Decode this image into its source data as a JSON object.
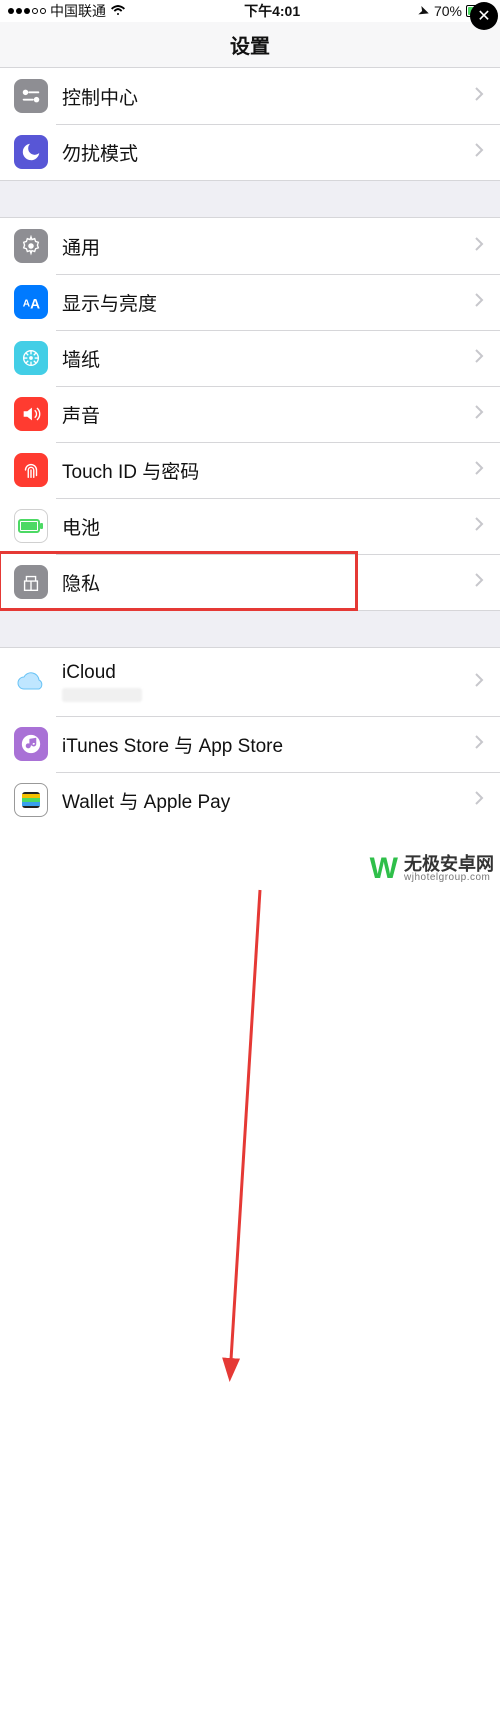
{
  "status": {
    "carrier": "中国联通",
    "time": "下午4:01",
    "battery_pct": "70%",
    "battery_fill_pct": 70
  },
  "navbar": {
    "title": "设置"
  },
  "groups": [
    {
      "items": [
        {
          "key": "control",
          "label": "控制中心"
        },
        {
          "key": "dnd",
          "label": "勿扰模式"
        }
      ]
    },
    {
      "items": [
        {
          "key": "general",
          "label": "通用"
        },
        {
          "key": "display",
          "label": "显示与亮度"
        },
        {
          "key": "wallpaper",
          "label": "墙纸"
        },
        {
          "key": "sound",
          "label": "声音"
        },
        {
          "key": "touchid",
          "label": "Touch ID 与密码"
        },
        {
          "key": "battery",
          "label": "电池"
        },
        {
          "key": "privacy",
          "label": "隐私",
          "highlighted": true
        }
      ]
    },
    {
      "items": [
        {
          "key": "icloud",
          "label": "iCloud",
          "has_sub": true
        },
        {
          "key": "itunes",
          "label": "iTunes Store 与 App Store"
        },
        {
          "key": "wallet",
          "label": "Wallet 与 Apple Pay"
        }
      ]
    }
  ],
  "annotation": {
    "arrow_from": {
      "row": "navbar"
    },
    "arrow_to": {
      "row": "privacy"
    },
    "highlight_row": "privacy"
  },
  "watermark": {
    "zh": "无极安卓网",
    "en": "wjhotelgroup.com"
  },
  "close_label": "✕"
}
